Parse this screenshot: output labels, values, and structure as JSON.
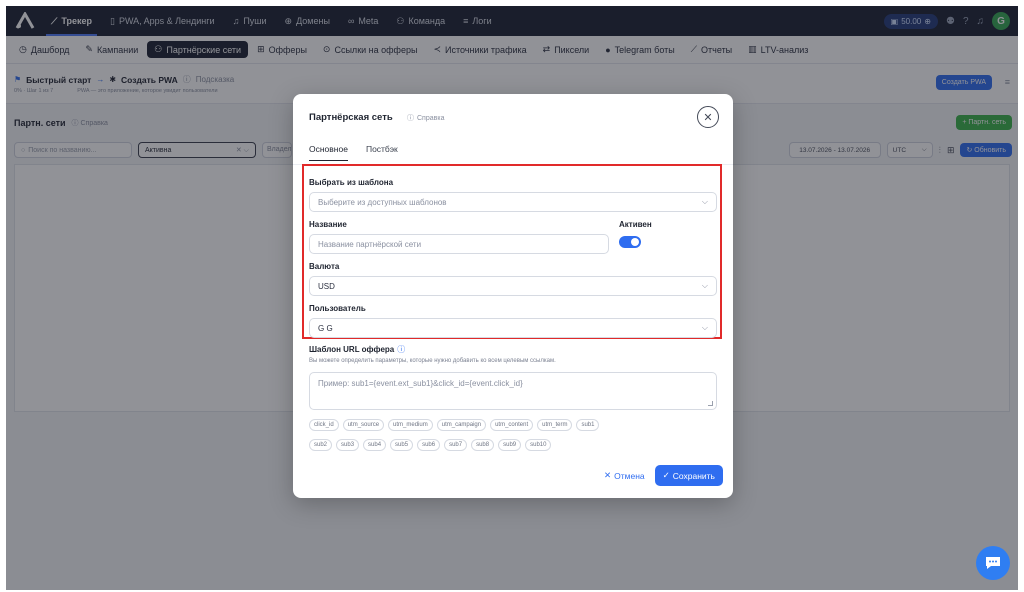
{
  "topnav": {
    "items": [
      {
        "label": "Трекер",
        "icon": "chart-line-icon",
        "active": true
      },
      {
        "label": "PWA, Apps & Лендинги",
        "icon": "phone-icon"
      },
      {
        "label": "Пуши",
        "icon": "bell-icon"
      },
      {
        "label": "Домены",
        "icon": "globe-icon"
      },
      {
        "label": "Meta",
        "icon": "infinity-icon"
      },
      {
        "label": "Команда",
        "icon": "users-icon"
      },
      {
        "label": "Логи",
        "icon": "list-icon"
      }
    ],
    "balance": "50.00"
  },
  "subnav": {
    "items": [
      {
        "label": "Дашборд",
        "icon": "clock-icon"
      },
      {
        "label": "Кампании",
        "icon": "edit-icon"
      },
      {
        "label": "Партнёрские сети",
        "icon": "users-icon",
        "active": true
      },
      {
        "label": "Офферы",
        "icon": "gift-icon"
      },
      {
        "label": "Ссылки на офферы",
        "icon": "pin-icon"
      },
      {
        "label": "Источники трафика",
        "icon": "share-icon"
      },
      {
        "label": "Пиксели",
        "icon": "arrows-icon"
      },
      {
        "label": "Telegram боты",
        "icon": "telegram-icon"
      },
      {
        "label": "Отчеты",
        "icon": "chart-line-icon"
      },
      {
        "label": "LTV-анализ",
        "icon": "bar-chart-icon"
      }
    ]
  },
  "quickstart": {
    "title": "Быстрый старт",
    "step": "Создать PWA",
    "hint": "Подсказка",
    "progress_text": "0% · Шаг 1 из 7",
    "description": "PWA — это приложение, которое увидит пользователи",
    "create_button": "Создать PWA"
  },
  "page": {
    "title": "Партн. сети",
    "help": "Справка",
    "add_button": "+ Партн. сеть",
    "search_placeholder": "Поиск по названию...",
    "status_filter": "Активна",
    "owner_filter": "Владелец",
    "date_range": "13.07.2026 - 13.07.2026",
    "timezone": "UTC",
    "refresh_button": "Обновить"
  },
  "modal": {
    "title": "Партнёрская сеть",
    "help": "Справка",
    "tabs": [
      "Основное",
      "Постбэк"
    ],
    "template_label": "Выбрать из шаблона",
    "template_placeholder": "Выберите из доступных шаблонов",
    "name_label": "Название",
    "name_placeholder": "Название партнёрской сети",
    "active_label": "Активен",
    "active": true,
    "currency_label": "Валюта",
    "currency_value": "USD",
    "user_label": "Пользователь",
    "user_value": "G G",
    "url_template_label": "Шаблон URL оффера",
    "url_template_desc": "Вы можете определить параметры, которые нужно добавить ко всем целевым ссылкам.",
    "url_template_placeholder": "Пример: sub1={event.ext_sub1}&click_id={event.click_id}",
    "chips_row1": [
      "click_id",
      "utm_source",
      "utm_medium",
      "utm_campaign",
      "utm_content",
      "utm_term",
      "sub1"
    ],
    "chips_row2": [
      "sub2",
      "sub3",
      "sub4",
      "sub5",
      "sub6",
      "sub7",
      "sub8",
      "sub9",
      "sub10"
    ],
    "cancel_button": "Отмена",
    "save_button": "Сохранить"
  },
  "colors": {
    "accent": "#2f6df0",
    "highlight": "#e12a2a",
    "nav_bg": "#1b2233",
    "success": "#3ab24a"
  }
}
